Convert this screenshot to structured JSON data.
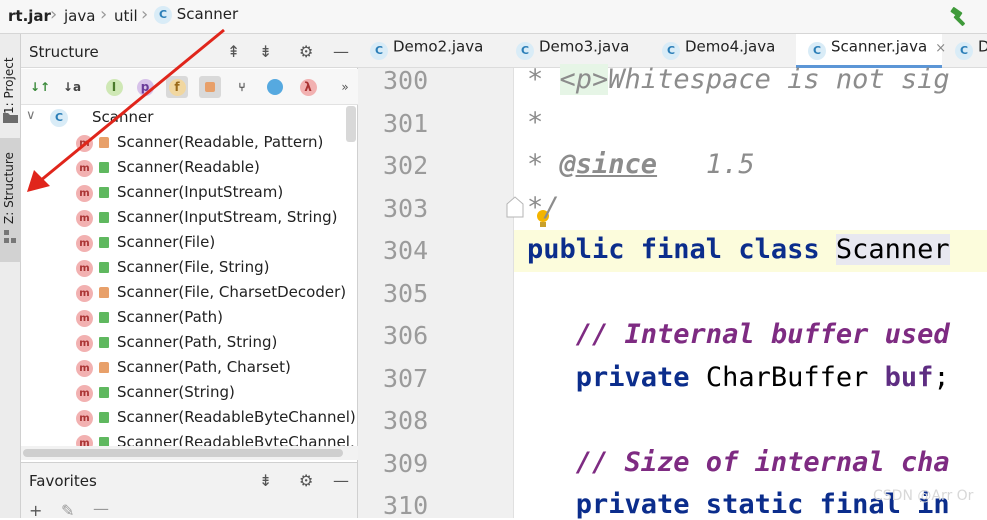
{
  "breadcrumb": {
    "items": [
      "rt.jar",
      "java",
      "util",
      "Scanner"
    ],
    "class_badge": "C"
  },
  "tool_strip": {
    "tab_project": "1: Project",
    "tab_structure": "Z: Structure"
  },
  "structure": {
    "title": "Structure",
    "toolbar": [
      "I",
      "p",
      "f"
    ],
    "root": "Scanner",
    "items": [
      {
        "label": "Scanner(Readable, Pattern)",
        "visibility": "private"
      },
      {
        "label": "Scanner(Readable)",
        "visibility": "public"
      },
      {
        "label": "Scanner(InputStream)",
        "visibility": "public"
      },
      {
        "label": "Scanner(InputStream, String)",
        "visibility": "public"
      },
      {
        "label": "Scanner(File)",
        "visibility": "public"
      },
      {
        "label": "Scanner(File, String)",
        "visibility": "public"
      },
      {
        "label": "Scanner(File, CharsetDecoder)",
        "visibility": "private"
      },
      {
        "label": "Scanner(Path)",
        "visibility": "public"
      },
      {
        "label": "Scanner(Path, String)",
        "visibility": "public"
      },
      {
        "label": "Scanner(Path, Charset)",
        "visibility": "private"
      },
      {
        "label": "Scanner(String)",
        "visibility": "public"
      },
      {
        "label": "Scanner(ReadableByteChannel)",
        "visibility": "public"
      },
      {
        "label": "Scanner(ReadableByteChannel, St",
        "visibility": "public"
      }
    ],
    "method_badge": "m"
  },
  "favorites": {
    "title": "Favorites"
  },
  "editor_tabs": [
    {
      "label": "Demo2.java",
      "active": false
    },
    {
      "label": "Demo3.java",
      "active": false
    },
    {
      "label": "Demo4.java",
      "active": false
    },
    {
      "label": "Scanner.java",
      "active": true
    },
    {
      "label": "D",
      "active": false
    }
  ],
  "editor": {
    "lines": [
      {
        "no": "300",
        "parts": [
          {
            "t": "* ",
            "c": "doc"
          },
          {
            "t": "<p>",
            "c": "doc htmltag"
          },
          {
            "t": "Whitespace is not sig",
            "c": "doc"
          }
        ]
      },
      {
        "no": "301",
        "parts": [
          {
            "t": "*",
            "c": "doc"
          }
        ]
      },
      {
        "no": "302",
        "parts": [
          {
            "t": "* ",
            "c": "doc"
          },
          {
            "t": "@since",
            "c": "doctag"
          },
          {
            "t": "   1.5",
            "c": "doc"
          }
        ]
      },
      {
        "no": "303",
        "parts": [
          {
            "t": "*/",
            "c": "doc"
          }
        ]
      },
      {
        "no": "304",
        "parts": [
          {
            "t": "public final class ",
            "c": "kw"
          },
          {
            "t": "Scanner",
            "c": "cls-hl"
          }
        ]
      },
      {
        "no": "305",
        "parts": []
      },
      {
        "no": "306",
        "parts": [
          {
            "t": "   // Internal buffer used",
            "c": "cmt"
          }
        ]
      },
      {
        "no": "307",
        "parts": [
          {
            "t": "   private ",
            "c": "kw"
          },
          {
            "t": "CharBuffer ",
            "c": ""
          },
          {
            "t": "buf",
            "c": "fld"
          },
          {
            "t": ";",
            "c": ""
          }
        ]
      },
      {
        "no": "308",
        "parts": []
      },
      {
        "no": "309",
        "parts": [
          {
            "t": "   // Size of internal cha",
            "c": "cmt"
          }
        ]
      },
      {
        "no": "310",
        "parts": [
          {
            "t": "   private static final in",
            "c": "kw"
          }
        ]
      }
    ]
  },
  "watermark": "CSDN @Arr Or",
  "colors": {
    "accent": "#5c96d6",
    "arrow": "#e0251b",
    "keyword": "#0b2d8c"
  }
}
